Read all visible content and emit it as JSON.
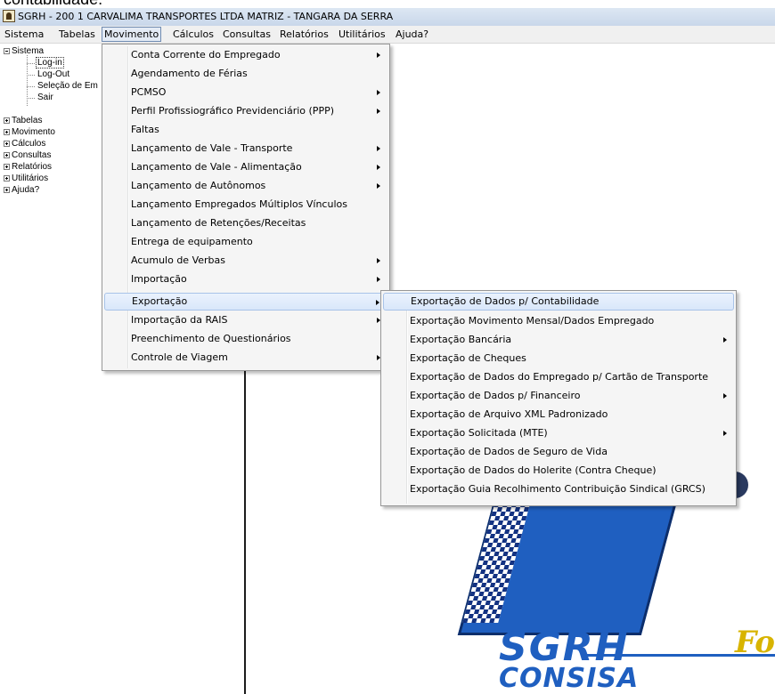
{
  "top_fragment": "contabilidade.",
  "window": {
    "title": "SGRH - 200 1 CARVALIMA TRANSPORTES LTDA MATRIZ - TANGARA DA SERRA"
  },
  "menubar": {
    "items": [
      {
        "label": "Sistema"
      },
      {
        "label": "Tabelas"
      },
      {
        "label": "Movimento"
      },
      {
        "label": "Cálculos"
      },
      {
        "label": "Consultas"
      },
      {
        "label": "Relatórios"
      },
      {
        "label": "Utilitários"
      },
      {
        "label": "Ajuda?"
      }
    ]
  },
  "tree": {
    "root": "Sistema",
    "children": [
      "Log-in",
      "Log-Out",
      "Seleção de Em",
      "Sair"
    ],
    "nodes": [
      "Tabelas",
      "Movimento",
      "Cálculos",
      "Consultas",
      "Relatórios",
      "Utilitários",
      "Ajuda?"
    ]
  },
  "movimento_menu": {
    "items": [
      {
        "label": "Conta Corrente do Empregado",
        "submenu": true
      },
      {
        "label": "Agendamento de Férias",
        "submenu": false
      },
      {
        "label": "PCMSO",
        "submenu": true
      },
      {
        "label": "Perfil Profissiográfico Previdenciário (PPP)",
        "submenu": true
      },
      {
        "label": "Faltas",
        "submenu": false
      },
      {
        "label": "Lançamento de Vale - Transporte",
        "submenu": true
      },
      {
        "label": "Lançamento de Vale - Alimentação",
        "submenu": true
      },
      {
        "label": "Lançamento de Autônomos",
        "submenu": true
      },
      {
        "label": "Lançamento Empregados Múltiplos Vínculos",
        "submenu": false
      },
      {
        "label": "Lançamento de Retenções/Receitas",
        "submenu": false
      },
      {
        "label": "Entrega de equipamento",
        "submenu": false
      },
      {
        "label": "Acumulo de Verbas",
        "submenu": true
      },
      {
        "label": "Importação",
        "submenu": true
      },
      {
        "label": "Exportação",
        "submenu": true
      },
      {
        "label": "Importação da RAIS",
        "submenu": true
      },
      {
        "label": "Preenchimento de Questionários",
        "submenu": false
      },
      {
        "label": "Controle de Viagem",
        "submenu": true
      }
    ]
  },
  "exportacao_menu": {
    "items": [
      {
        "label": "Exportação de Dados p/ Contabilidade",
        "submenu": false
      },
      {
        "label": "Exportação Movimento Mensal/Dados Empregado",
        "submenu": false
      },
      {
        "label": "Exportação Bancária",
        "submenu": true
      },
      {
        "label": "Exportação de Cheques",
        "submenu": false
      },
      {
        "label": "Exportação de Dados do Empregado p/ Cartão de Transporte",
        "submenu": false
      },
      {
        "label": "Exportação de Dados p/ Financeiro",
        "submenu": true
      },
      {
        "label": "Exportação de Arquivo XML Padronizado",
        "submenu": false
      },
      {
        "label": "Exportação Solicitada (MTE)",
        "submenu": true
      },
      {
        "label": "Exportação de Dados de Seguro de Vida",
        "submenu": false
      },
      {
        "label": "Exportação de Dados do Holerite (Contra Cheque)",
        "submenu": false
      },
      {
        "label": "Exportação Guia Recolhimento Contribuição Sindical (GRCS)",
        "submenu": false
      }
    ]
  },
  "logo": {
    "main": "SGRH",
    "sub": "CONSISA",
    "side": "Fo"
  },
  "colors": {
    "menu_highlight": "#d9e7fa",
    "logo_blue": "#1f5fc0",
    "logo_yellow": "#f4c21d"
  }
}
